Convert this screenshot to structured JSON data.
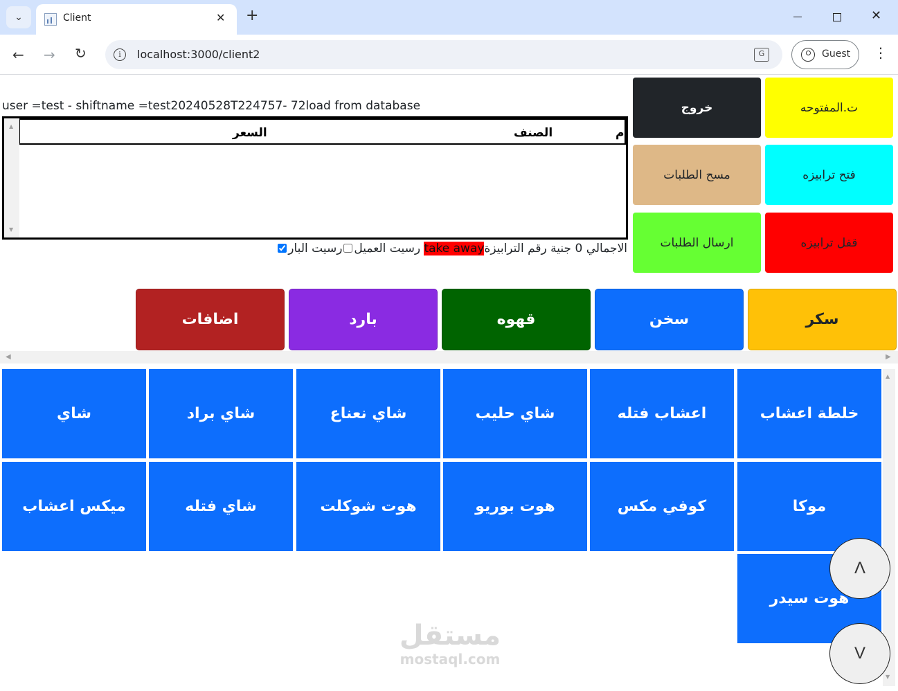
{
  "browser": {
    "tab_title": "Client",
    "url": "localhost:3000/client2",
    "profile_label": "Guest"
  },
  "status_text": "user =test - shiftname =test20240528T224757- 72load from database",
  "table": {
    "headers": {
      "index": "م",
      "item": "الصنف",
      "price": "السعر"
    }
  },
  "totals": {
    "total_label": "الاجمالي",
    "total_value": "0",
    "currency": "جنية",
    "table_number_label": "رقم الترابيزة",
    "takeaway_label": "take away",
    "customer_receipt_label": "رسيت العميل",
    "customer_receipt_checked": false,
    "bar_receipt_label": "رسيت البار",
    "bar_receipt_checked": true
  },
  "controls": {
    "open_tables": {
      "label": "ت.المفتوحه",
      "color": "#ffff00"
    },
    "exit": {
      "label": "خروج",
      "color": "#212529"
    },
    "open_table": {
      "label": "فتح ترابيزه",
      "color": "#00ffff"
    },
    "clear_orders": {
      "label": "مسح الطلبات",
      "color": "#deb887"
    },
    "close_table": {
      "label": "قفل ترابيزه",
      "color": "#ff0000"
    },
    "send_orders": {
      "label": "ارسال الطلبات",
      "color": "#66ff33"
    }
  },
  "categories": [
    {
      "label": "سكر",
      "color": "#ffc107",
      "text_color": "#212529"
    },
    {
      "label": "سخن",
      "color": "#0d6efd",
      "text_color": "#ffffff"
    },
    {
      "label": "قهوه",
      "color": "#006400",
      "text_color": "#ffffff"
    },
    {
      "label": "بارد",
      "color": "#8a2be2",
      "text_color": "#ffffff"
    },
    {
      "label": "اضافات",
      "color": "#b22222",
      "text_color": "#ffffff"
    }
  ],
  "items": [
    "خلطة اعشاب",
    "اعشاب فتله",
    "شاي حليب",
    "شاي نعناع",
    "شاي براد",
    "شاي",
    "موكا",
    "كوفي مكس",
    "هوت بوريو",
    "هوت شوكلت",
    "شاي فتله",
    "ميكس اعشاب",
    "هوت سيدر"
  ],
  "scroll_buttons": {
    "up": "Λ",
    "down": "V"
  },
  "watermark": {
    "arabic": "مستقل",
    "latin": "mostaql.com"
  }
}
